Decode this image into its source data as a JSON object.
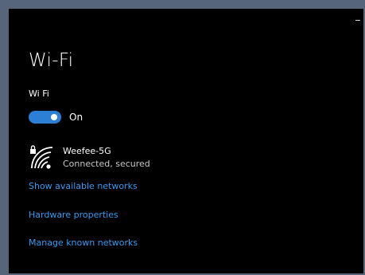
{
  "page": {
    "title": "Wi-Fi",
    "section_label": "Wi Fi"
  },
  "toggle": {
    "state_label": "On",
    "on": true,
    "accent_color": "#2b7fd4"
  },
  "network": {
    "name": "Weefee-5G",
    "status": "Connected, secured",
    "icon": "wifi-secured-icon"
  },
  "links": {
    "show_available": "Show available networks",
    "hardware_properties": "Hardware properties",
    "manage_known": "Manage known networks",
    "color": "#3a9af0"
  }
}
